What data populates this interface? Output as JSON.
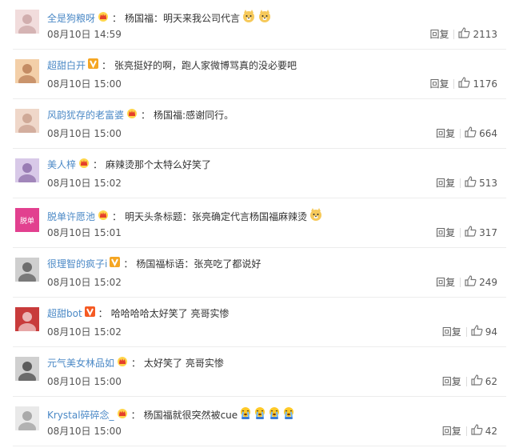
{
  "colors": {
    "username": "#4b89c6",
    "text": "#333333",
    "meta": "#555555",
    "divider": "#ececec"
  },
  "comments": [
    {
      "username": "全是狗粮呀",
      "badge": "crown-icon",
      "text": "杨国福：明天来我公司代言",
      "emojis": [
        "doge-icon",
        "doge-icon"
      ],
      "time": "08月10日 14:59",
      "reply": "回复",
      "likes": "2113"
    },
    {
      "username": "超甜白开",
      "badge": "vip-v-icon",
      "text": "张亮挺好的啊，跑人家微博骂真的没必要吧",
      "emojis": [],
      "time": "08月10日 15:00",
      "reply": "回复",
      "likes": "1176"
    },
    {
      "username": "风韵犹存的老富婆",
      "badge": "crown-icon",
      "text": "杨国福:感谢同行。",
      "emojis": [],
      "time": "08月10日 15:00",
      "reply": "回复",
      "likes": "664"
    },
    {
      "username": "美人梓",
      "badge": "crown-icon",
      "text": "麻辣烫那个太特么好笑了",
      "emojis": [],
      "time": "08月10日 15:02",
      "reply": "回复",
      "likes": "513"
    },
    {
      "username": "脱单许愿池",
      "badge": "crown-icon",
      "text": "明天头条标题：张亮确定代言杨国福麻辣烫",
      "emojis": [
        "doge-icon"
      ],
      "time": "08月10日 15:01",
      "reply": "回复",
      "likes": "317"
    },
    {
      "username": "很理智的疯子i",
      "badge": "vip-v-icon",
      "text": "杨国福标语：张亮吃了都说好",
      "emojis": [],
      "time": "08月10日 15:02",
      "reply": "回复",
      "likes": "249"
    },
    {
      "username": "超甜bot",
      "badge": "vip-v-red-icon",
      "text": "哈哈哈哈太好笑了 亮哥实惨",
      "emojis": [],
      "time": "08月10日 15:02",
      "reply": "回复",
      "likes": "94"
    },
    {
      "username": "元气美女林品如",
      "badge": "crown-icon",
      "text": "太好笑了 亮哥实惨",
      "emojis": [],
      "time": "08月10日 15:00",
      "reply": "回复",
      "likes": "62"
    },
    {
      "username": "Krystal碎碎念_",
      "badge": "crown-icon",
      "text": "杨国福就很突然被cue",
      "emojis": [
        "crying-icon",
        "crying-icon",
        "crying-icon",
        "crying-icon"
      ],
      "time": "08月10日 15:00",
      "reply": "回复",
      "likes": "42"
    }
  ]
}
